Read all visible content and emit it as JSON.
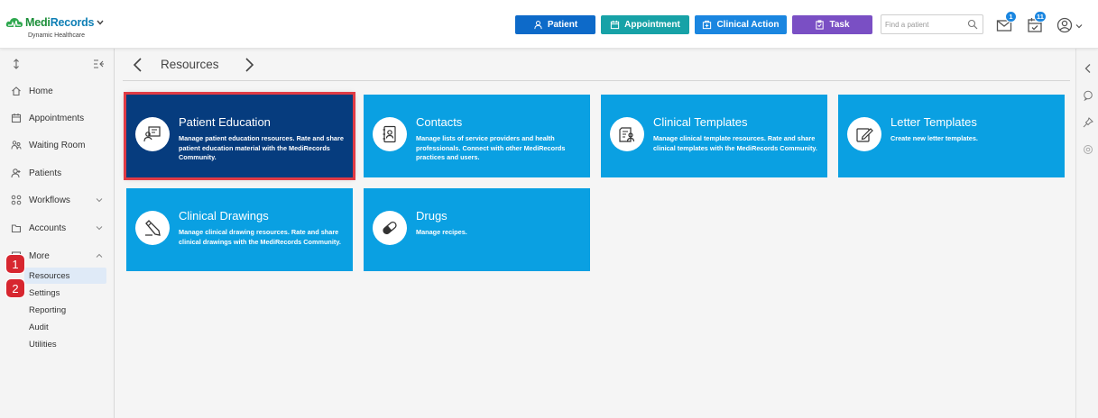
{
  "header": {
    "brand_main": "Medi",
    "brand_accent": "Records",
    "brand_subtitle": "Dynamic Healthcare",
    "buttons": {
      "patient": "Patient",
      "appointment": "Appointment",
      "clinical_action": "Clinical Action",
      "task": "Task"
    },
    "search_placeholder": "Find a patient",
    "mail_count": "1",
    "task_count": "11"
  },
  "sidebar": {
    "items": [
      {
        "label": "Home",
        "icon": "home-icon"
      },
      {
        "label": "Appointments",
        "icon": "calendar-icon"
      },
      {
        "label": "Waiting Room",
        "icon": "waiting-room-icon"
      },
      {
        "label": "Patients",
        "icon": "patients-icon"
      },
      {
        "label": "Workflows",
        "icon": "workflows-icon"
      },
      {
        "label": "Accounts",
        "icon": "accounts-icon"
      },
      {
        "label": "More",
        "icon": "more-icon"
      }
    ],
    "sub_items": [
      "Resources",
      "Settings",
      "Reporting",
      "Audit",
      "Utilities"
    ],
    "step_markers": [
      "1",
      "2"
    ]
  },
  "breadcrumb": {
    "title": "Resources"
  },
  "cards": [
    {
      "title": "Patient Education",
      "description": "Manage patient education resources. Rate and share patient education material with the MediRecords Community.",
      "icon": "patient-education-icon"
    },
    {
      "title": "Contacts",
      "description": "Manage lists of service providers and health professionals. Connect with other MediRecords practices and users.",
      "icon": "contacts-icon"
    },
    {
      "title": "Clinical Templates",
      "description": "Manage clinical template resources. Rate and share clinical templates with the MediRecords Community.",
      "icon": "clinical-templates-icon"
    },
    {
      "title": "Letter Templates",
      "description": "Create new letter templates.",
      "icon": "letter-templates-icon"
    },
    {
      "title": "Clinical Drawings",
      "description": "Manage clinical drawing resources. Rate and share clinical drawings with the MediRecords Community.",
      "icon": "clinical-drawings-icon"
    },
    {
      "title": "Drugs",
      "description": "Manage recipes.",
      "icon": "drugs-icon"
    }
  ],
  "colors": {
    "card": "#0aa0e2",
    "card_selected": "#063c7e",
    "highlight": "#e03b45",
    "patient_btn": "#0d6ac9",
    "appointment_btn": "#17a2a7",
    "clinical_btn": "#1a86e0",
    "task_btn": "#7a4fc4"
  }
}
